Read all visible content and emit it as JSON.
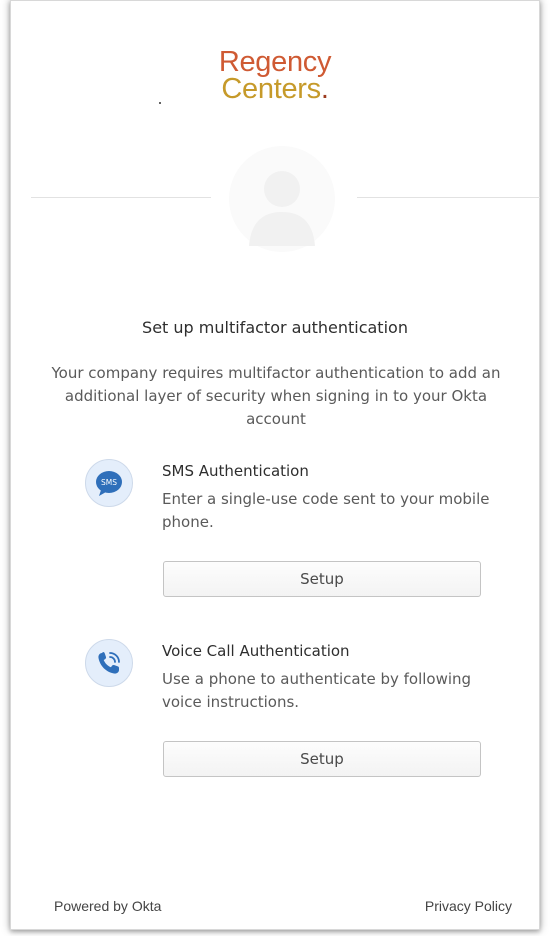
{
  "logo": {
    "line1": "Regency",
    "line2": "Centers",
    "period": ".",
    "brand_color_primary": "#cf5a33",
    "brand_color_secondary": "#c69a2a"
  },
  "avatar_icon": "user-silhouette-icon",
  "heading": "Set up multifactor authentication",
  "description": "Your company requires multifactor authentication to add an additional layer of security when signing in to your Okta account",
  "factors": [
    {
      "icon": "sms-bubble-icon",
      "icon_text": "SMS",
      "title": "SMS Authentication",
      "description": "Enter a single-use code sent to your mobile phone.",
      "button_label": "Setup"
    },
    {
      "icon": "phone-call-icon",
      "title": "Voice Call Authentication",
      "description": "Use a phone to authenticate by following voice instructions.",
      "button_label": "Setup"
    }
  ],
  "footer": {
    "powered_by": "Powered by Okta",
    "privacy_policy": "Privacy Policy"
  }
}
